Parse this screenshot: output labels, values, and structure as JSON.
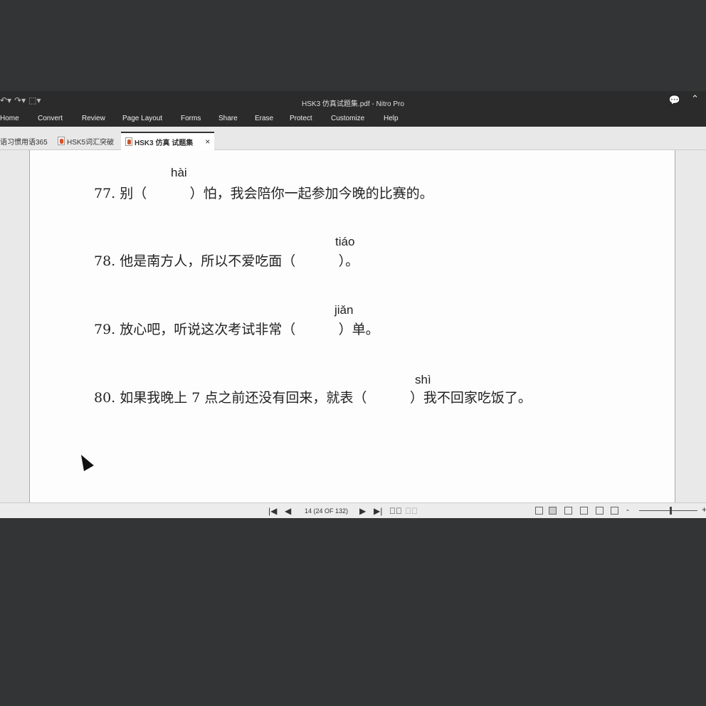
{
  "window": {
    "title": "HSK3 仿真试题集.pdf - Nitro Pro"
  },
  "menu": [
    "Home",
    "Convert",
    "Review",
    "Page Layout",
    "Forms",
    "Share",
    "Erase",
    "Protect",
    "Customize",
    "Help"
  ],
  "tabs": [
    {
      "label": "语习惯用语365"
    },
    {
      "label": "HSK5词汇突破"
    },
    {
      "label": "HSK3 仿真 试题集",
      "close": "×"
    }
  ],
  "questions": [
    {
      "num": "77.",
      "text": "别（          ）怕，我会陪你一起参加今晚的比赛的。",
      "pinyin": "hài"
    },
    {
      "num": "78.",
      "text": "他是南方人，所以不爱吃面（          ）。",
      "pinyin": "tiáo"
    },
    {
      "num": "79.",
      "text": "放心吧，听说这次考试非常（          ）单。",
      "pinyin": "jiǎn"
    },
    {
      "num": "80.",
      "text": "如果我晚上 7 点之前还没有回来，就表（          ）我不回家吃饭了。",
      "pinyin": "shì"
    }
  ],
  "status": {
    "page_indicator": "14 (24 OF 132)",
    "zoom_minus": "-",
    "zoom_plus": "+"
  }
}
